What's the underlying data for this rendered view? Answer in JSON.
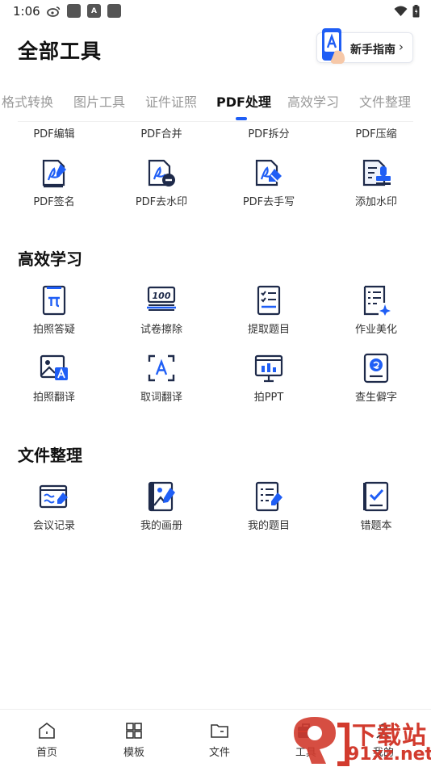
{
  "status_bar": {
    "time": "1:06",
    "icon_a": "A"
  },
  "header": {
    "title": "全部工具",
    "guide_button": {
      "label": "新手指南",
      "chevron": "›"
    }
  },
  "tabs": [
    {
      "label": "格式转换",
      "active": false
    },
    {
      "label": "图片工具",
      "active": false
    },
    {
      "label": "证件证照",
      "active": false
    },
    {
      "label": "PDF处理",
      "active": true
    },
    {
      "label": "高效学习",
      "active": false
    },
    {
      "label": "文件整理",
      "active": false
    }
  ],
  "pdf_section": {
    "top_row_labels": [
      "PDF编辑",
      "PDF合并",
      "PDF拆分",
      "PDF压缩"
    ],
    "tools": [
      {
        "label": "PDF签名",
        "icon": "pdf-sign-icon"
      },
      {
        "label": "PDF去水印",
        "icon": "pdf-remove-watermark-icon"
      },
      {
        "label": "PDF去手写",
        "icon": "pdf-remove-handwriting-icon"
      },
      {
        "label": "添加水印",
        "icon": "add-watermark-icon"
      }
    ]
  },
  "study_section": {
    "title": "高效学习",
    "tools": [
      {
        "label": "拍照答疑",
        "icon": "photo-qa-icon"
      },
      {
        "label": "试卷擦除",
        "icon": "exam-erase-icon"
      },
      {
        "label": "提取题目",
        "icon": "extract-questions-icon"
      },
      {
        "label": "作业美化",
        "icon": "homework-beautify-icon"
      },
      {
        "label": "拍照翻译",
        "icon": "photo-translate-icon"
      },
      {
        "label": "取词翻译",
        "icon": "word-translate-icon"
      },
      {
        "label": "拍PPT",
        "icon": "photo-ppt-icon"
      },
      {
        "label": "查生僻字",
        "icon": "rare-character-icon"
      }
    ]
  },
  "file_section": {
    "title": "文件整理",
    "tools": [
      {
        "label": "会议记录",
        "icon": "meeting-notes-icon"
      },
      {
        "label": "我的画册",
        "icon": "my-album-icon"
      },
      {
        "label": "我的题目",
        "icon": "my-questions-icon"
      },
      {
        "label": "错题本",
        "icon": "mistake-book-icon"
      }
    ]
  },
  "bottom_nav": [
    {
      "label": "首页",
      "icon": "home-icon"
    },
    {
      "label": "模板",
      "icon": "template-icon"
    },
    {
      "label": "文件",
      "icon": "folder-icon"
    },
    {
      "label": "工具",
      "icon": "toolbox-icon"
    },
    {
      "label": "我的",
      "icon": "profile-icon"
    }
  ],
  "watermark": {
    "top": "下载站",
    "bottom": "91xz.net"
  },
  "colors": {
    "accent": "#1f5ef5",
    "icon_dark": "#1e2a4a",
    "watermark": "#d23b2e"
  }
}
